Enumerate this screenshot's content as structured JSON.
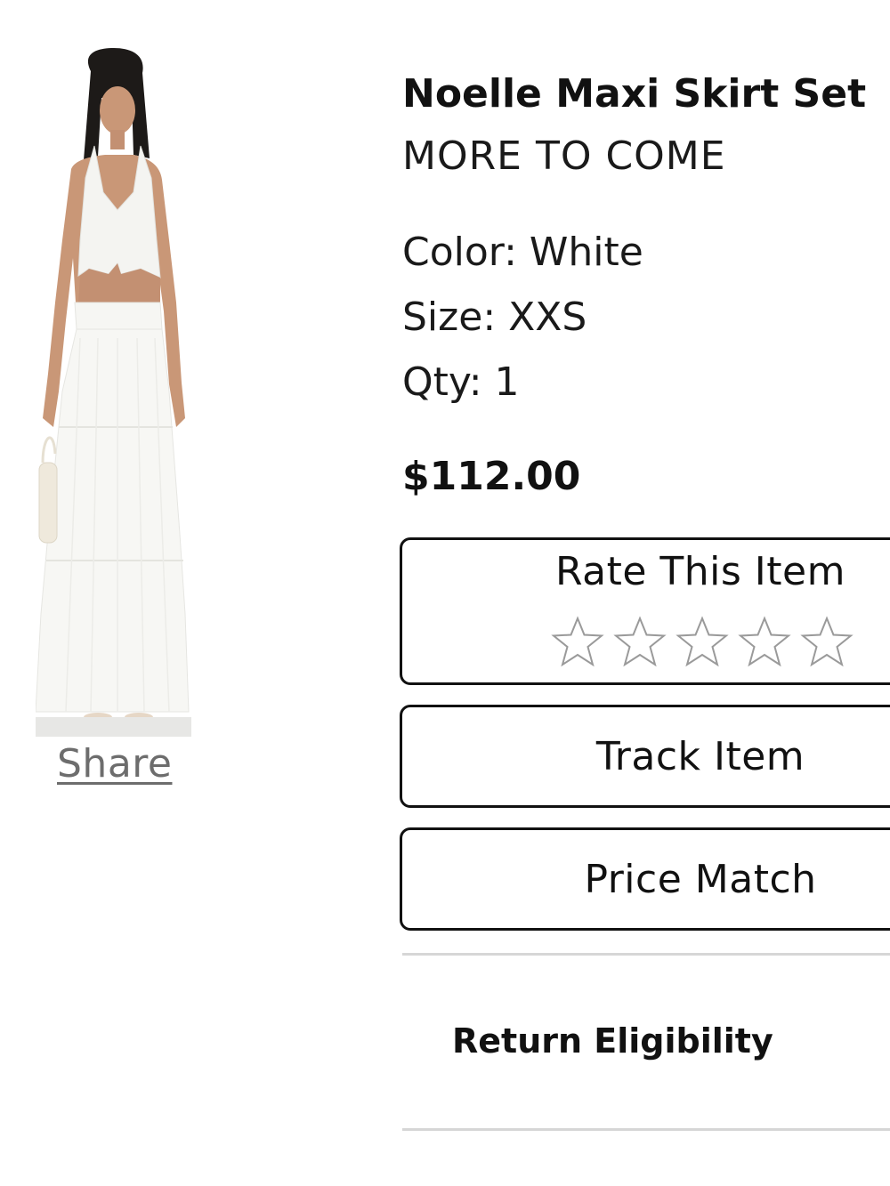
{
  "product": {
    "name": "Noelle Maxi Skirt Set",
    "brand": "MORE TO COME",
    "color_line": "Color: White",
    "size_line": "Size: XXS",
    "qty_line": "Qty: 1",
    "price": "$112.00",
    "image_icon": "product-photo"
  },
  "share": {
    "label": "Share"
  },
  "rating": {
    "label": "Rate This Item",
    "star_icon": "star-outline-icon",
    "max_stars": 5,
    "current": 0
  },
  "actions": {
    "track_label": "Track Item",
    "price_match_label": "Price Match"
  },
  "returns": {
    "label": "Return Eligibility"
  },
  "colors": {
    "text": "#111111",
    "share_link": "#6d6d6d",
    "border": "#111111",
    "divider": "#d6d6d6",
    "star_outline": "#9a9a9a"
  }
}
